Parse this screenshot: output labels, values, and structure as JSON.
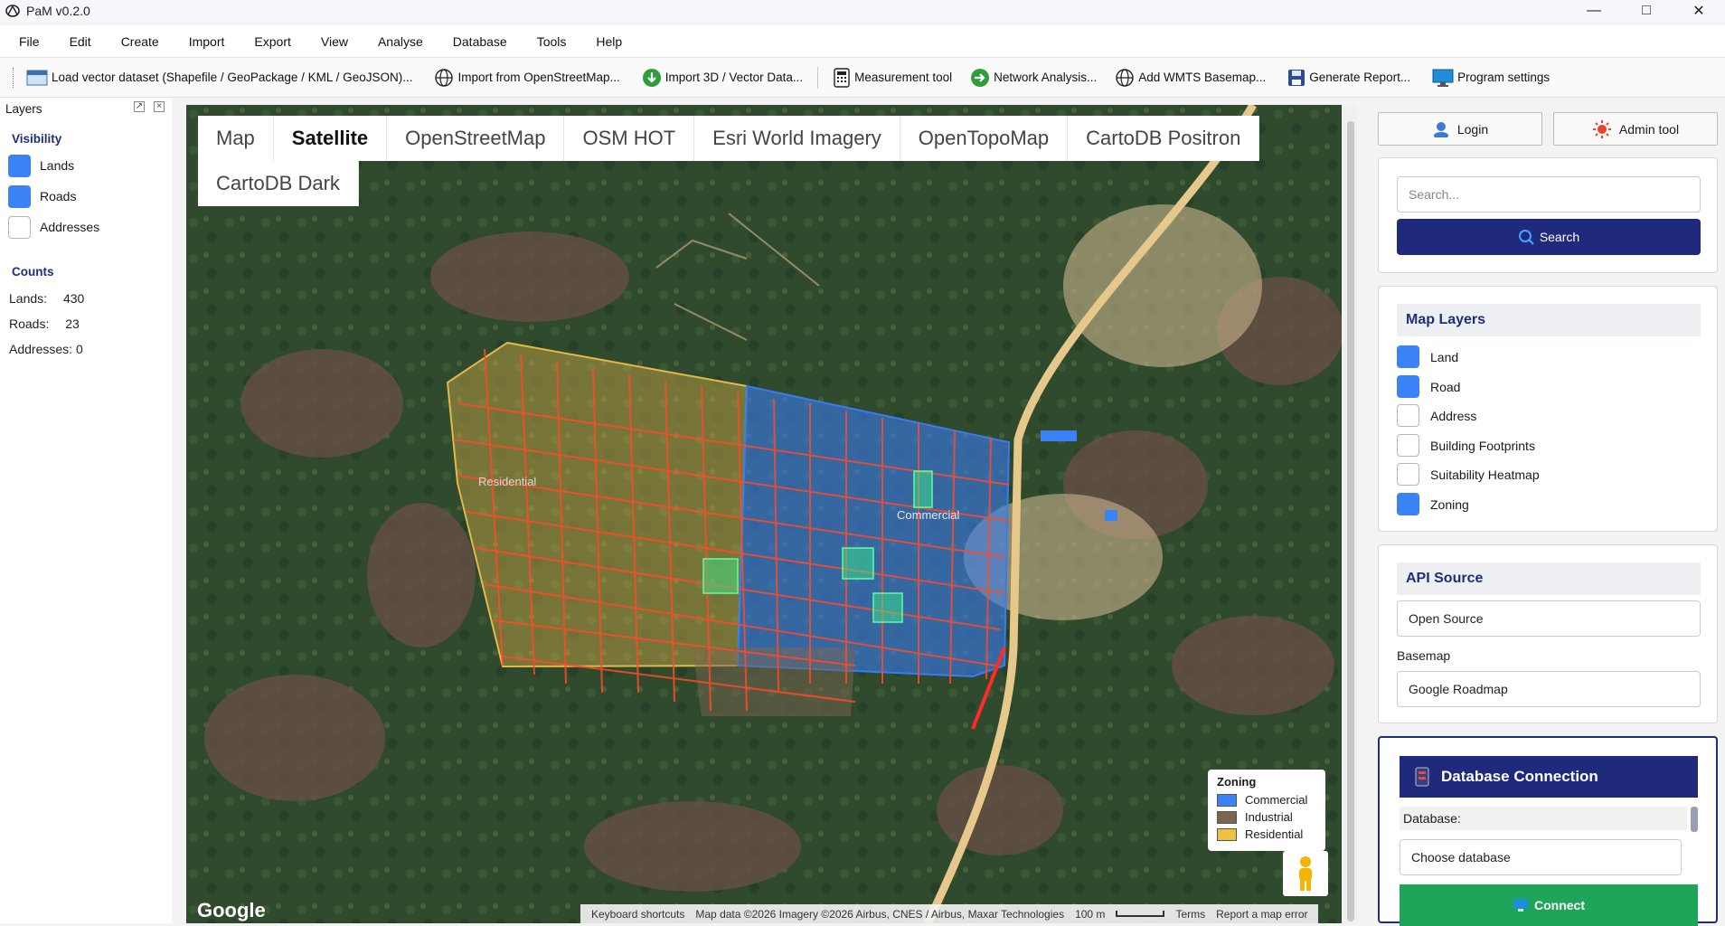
{
  "app": {
    "title": "PaM v0.2.0"
  },
  "window_controls": {
    "minimize": "—",
    "maximize": "□",
    "close": "✕"
  },
  "menu": [
    "File",
    "Edit",
    "Create",
    "Import",
    "Export",
    "View",
    "Analyse",
    "Database",
    "Tools",
    "Help"
  ],
  "toolbar": {
    "load_vector": "Load vector dataset (Shapefile / GeoPackage / KML / GeoJSON)...",
    "import_osm": "Import from OpenStreetMap...",
    "import_3d": "Import 3D / Vector Data...",
    "measurement": "Measurement tool",
    "network": "Network Analysis...",
    "wmts": "Add WMTS Basemap...",
    "report": "Generate Report...",
    "settings": "Program settings"
  },
  "layers_panel": {
    "title": "Layers",
    "visibility_title": "Visibility",
    "visibility": [
      {
        "label": "Lands",
        "checked": true
      },
      {
        "label": "Roads",
        "checked": true
      },
      {
        "label": "Addresses",
        "checked": false
      }
    ],
    "counts_title": "Counts",
    "counts": [
      {
        "label": "Lands:",
        "value": "430"
      },
      {
        "label": "Roads:",
        "value": "23"
      },
      {
        "label": "Addresses:",
        "value": "0"
      }
    ]
  },
  "map": {
    "tabs": [
      "Map",
      "Satellite",
      "OpenStreetMap",
      "OSM HOT",
      "Esri World Imagery",
      "OpenTopoMap",
      "CartoDB Positron",
      "CartoDB Dark"
    ],
    "active_tab": "Satellite",
    "labels": {
      "residential": "Residential",
      "commercial": "Commercial"
    },
    "legend": {
      "title": "Zoning",
      "items": [
        {
          "label": "Commercial",
          "color": "#3b82f6"
        },
        {
          "label": "Industrial",
          "color": "#7a6650"
        },
        {
          "label": "Residential",
          "color": "#f0c040"
        }
      ]
    },
    "google": "Google",
    "attribution": {
      "shortcuts": "Keyboard shortcuts",
      "data": "Map data ©2026 Imagery ©2026 Airbus, CNES / Airbus, Maxar Technologies",
      "scale": "100 m",
      "terms": "Terms",
      "report": "Report a map error"
    }
  },
  "right_panel": {
    "login": "Login",
    "admin": "Admin tool",
    "search_placeholder": "Search...",
    "search_button": "Search",
    "map_layers_title": "Map Layers",
    "map_layers": [
      {
        "label": "Land",
        "checked": true
      },
      {
        "label": "Road",
        "checked": true
      },
      {
        "label": "Address",
        "checked": false
      },
      {
        "label": "Building Footprints",
        "checked": false
      },
      {
        "label": "Suitability Heatmap",
        "checked": false
      },
      {
        "label": "Zoning",
        "checked": true
      }
    ],
    "api_title": "API Source",
    "api_value": "Open Source",
    "basemap_label": "Basemap",
    "basemap_value": "Google Roadmap",
    "db_title": "Database Connection",
    "db_label": "Database:",
    "db_value": "Choose database",
    "connect": "Connect"
  }
}
